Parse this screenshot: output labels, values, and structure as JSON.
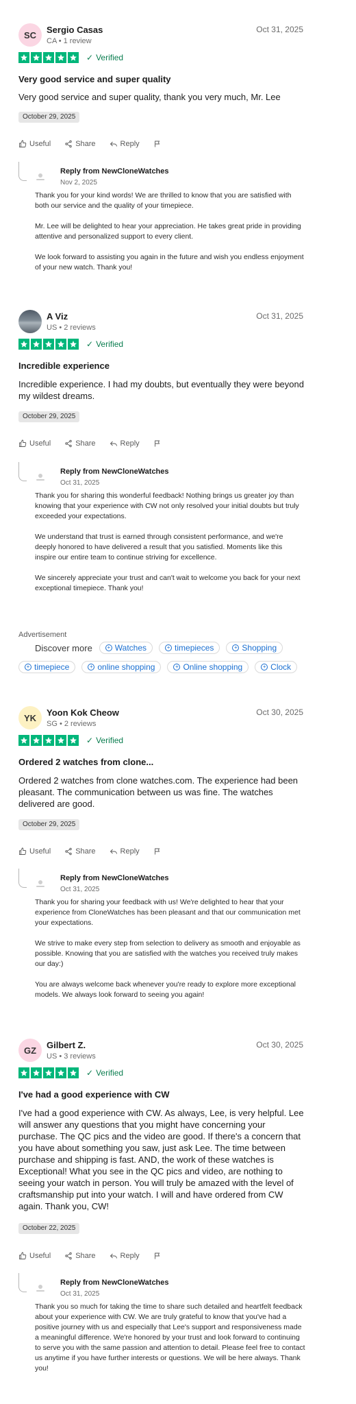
{
  "reviews": [
    {
      "avatar_initials": "SC",
      "name": "Sergio Casas",
      "meta": "CA • 1 review",
      "date": "Oct 31, 2025",
      "stars": 5,
      "verified": "Verified",
      "title": "Very good service and super quality",
      "body": "Very good service and super quality, thank you very much, Mr. Lee",
      "experience_date": "October 29, 2025",
      "actions": {
        "useful": "Useful",
        "share": "Share",
        "reply": "Reply"
      },
      "reply": {
        "from": "Reply from NewCloneWatches",
        "date": "Nov 2, 2025",
        "paragraphs": [
          "Thank you for your kind words! We are thrilled to know that you are satisfied with both our service and the quality of your timepiece.",
          "Mr. Lee will be delighted to hear your appreciation. He takes great pride in providing attentive and personalized support to every client.",
          "We look forward to assisting you again in the future and wish you endless enjoyment of your new watch. Thank you!"
        ]
      }
    },
    {
      "avatar_initials": "",
      "name": "A Viz",
      "meta": "US • 2 reviews",
      "date": "Oct 31, 2025",
      "stars": 5,
      "verified": "Verified",
      "title": "Incredible experience",
      "body": "Incredible experience. I had my doubts, but eventually they were beyond my wildest dreams.",
      "experience_date": "October 29, 2025",
      "actions": {
        "useful": "Useful",
        "share": "Share",
        "reply": "Reply"
      },
      "reply": {
        "from": "Reply from NewCloneWatches",
        "date": "Oct 31, 2025",
        "paragraphs": [
          "Thank you for sharing this wonderful feedback! Nothing brings us greater joy than knowing that your experience with CW not only resolved your initial doubts but truly exceeded your expectations.",
          "We understand that trust is earned through consistent performance, and we're deeply honored to have delivered a result that you satisfied. Moments like this inspire our entire team to continue striving for excellence.",
          "We sincerely appreciate your trust and can't wait to welcome you back for your next exceptional timepiece. Thank you!"
        ]
      }
    },
    {
      "avatar_initials": "YK",
      "name": "Yoon Kok Cheow",
      "meta": "SG • 2 reviews",
      "date": "Oct 30, 2025",
      "stars": 5,
      "verified": "Verified",
      "title": "Ordered 2 watches from clone...",
      "body": "Ordered 2 watches from clone watches.com. The experience had been pleasant. The communication between us was fine. The watches delivered are good.",
      "experience_date": "October 29, 2025",
      "actions": {
        "useful": "Useful",
        "share": "Share",
        "reply": "Reply"
      },
      "reply": {
        "from": "Reply from NewCloneWatches",
        "date": "Oct 31, 2025",
        "paragraphs": [
          "Thank you for sharing your feedback with us! We're delighted to hear that your experience from CloneWatches has been pleasant and that our communication met your expectations.",
          "We strive to make every step from selection to delivery as smooth and enjoyable as possible. Knowing that you are satisfied with the watches you received truly makes our day:)",
          "You are always welcome back whenever you're ready to explore more exceptional models. We always look forward to seeing you again!"
        ]
      }
    },
    {
      "avatar_initials": "GZ",
      "name": "Gilbert Z.",
      "meta": "US • 3 reviews",
      "date": "Oct 30, 2025",
      "stars": 5,
      "verified": "Verified",
      "title": "I've had a good experience with CW",
      "body": "I've had a good experience with CW. As always, Lee, is very helpful. Lee will answer any questions that you might have concerning your purchase. The QC pics and the video are good. If there's a concern that you have about something you saw, just ask Lee. The time between purchase and shipping is fast. AND, the work of these watches is Exceptional! What you see in the QC pics and video, are nothing to seeing your watch in person. You will truly be amazed with the level of craftsmanship put into your watch. I will and have ordered from CW again. Thank you, CW!",
      "experience_date": "October 22, 2025",
      "actions": {
        "useful": "Useful",
        "share": "Share",
        "reply": "Reply"
      },
      "reply": {
        "from": "Reply from NewCloneWatches",
        "date": "Oct 31, 2025",
        "paragraphs": [
          "Thank you so much for taking the time to share such detailed and heartfelt feedback about your experience with CW. We are truly grateful to know that you've had a positive journey with us and especially that Lee's support and responsiveness made a meaningful difference. We're honored by your trust and look forward to continuing to serve you with the same passion and attention to detail. Please feel free to contact us anytime if you have further interests or questions. We will be here always. Thank you!"
        ]
      }
    }
  ],
  "advertisement": {
    "label": "Advertisement",
    "discover": "Discover more",
    "chips_row1": [
      "Watches",
      "timepieces",
      "Shopping"
    ],
    "chips_row2": [
      "timepiece",
      "online shopping",
      "Online shopping",
      "Clock"
    ]
  },
  "colors": {
    "star_green": "#00b67a",
    "verified_green": "#0a7d4f",
    "link_blue": "#1a6fd1"
  }
}
